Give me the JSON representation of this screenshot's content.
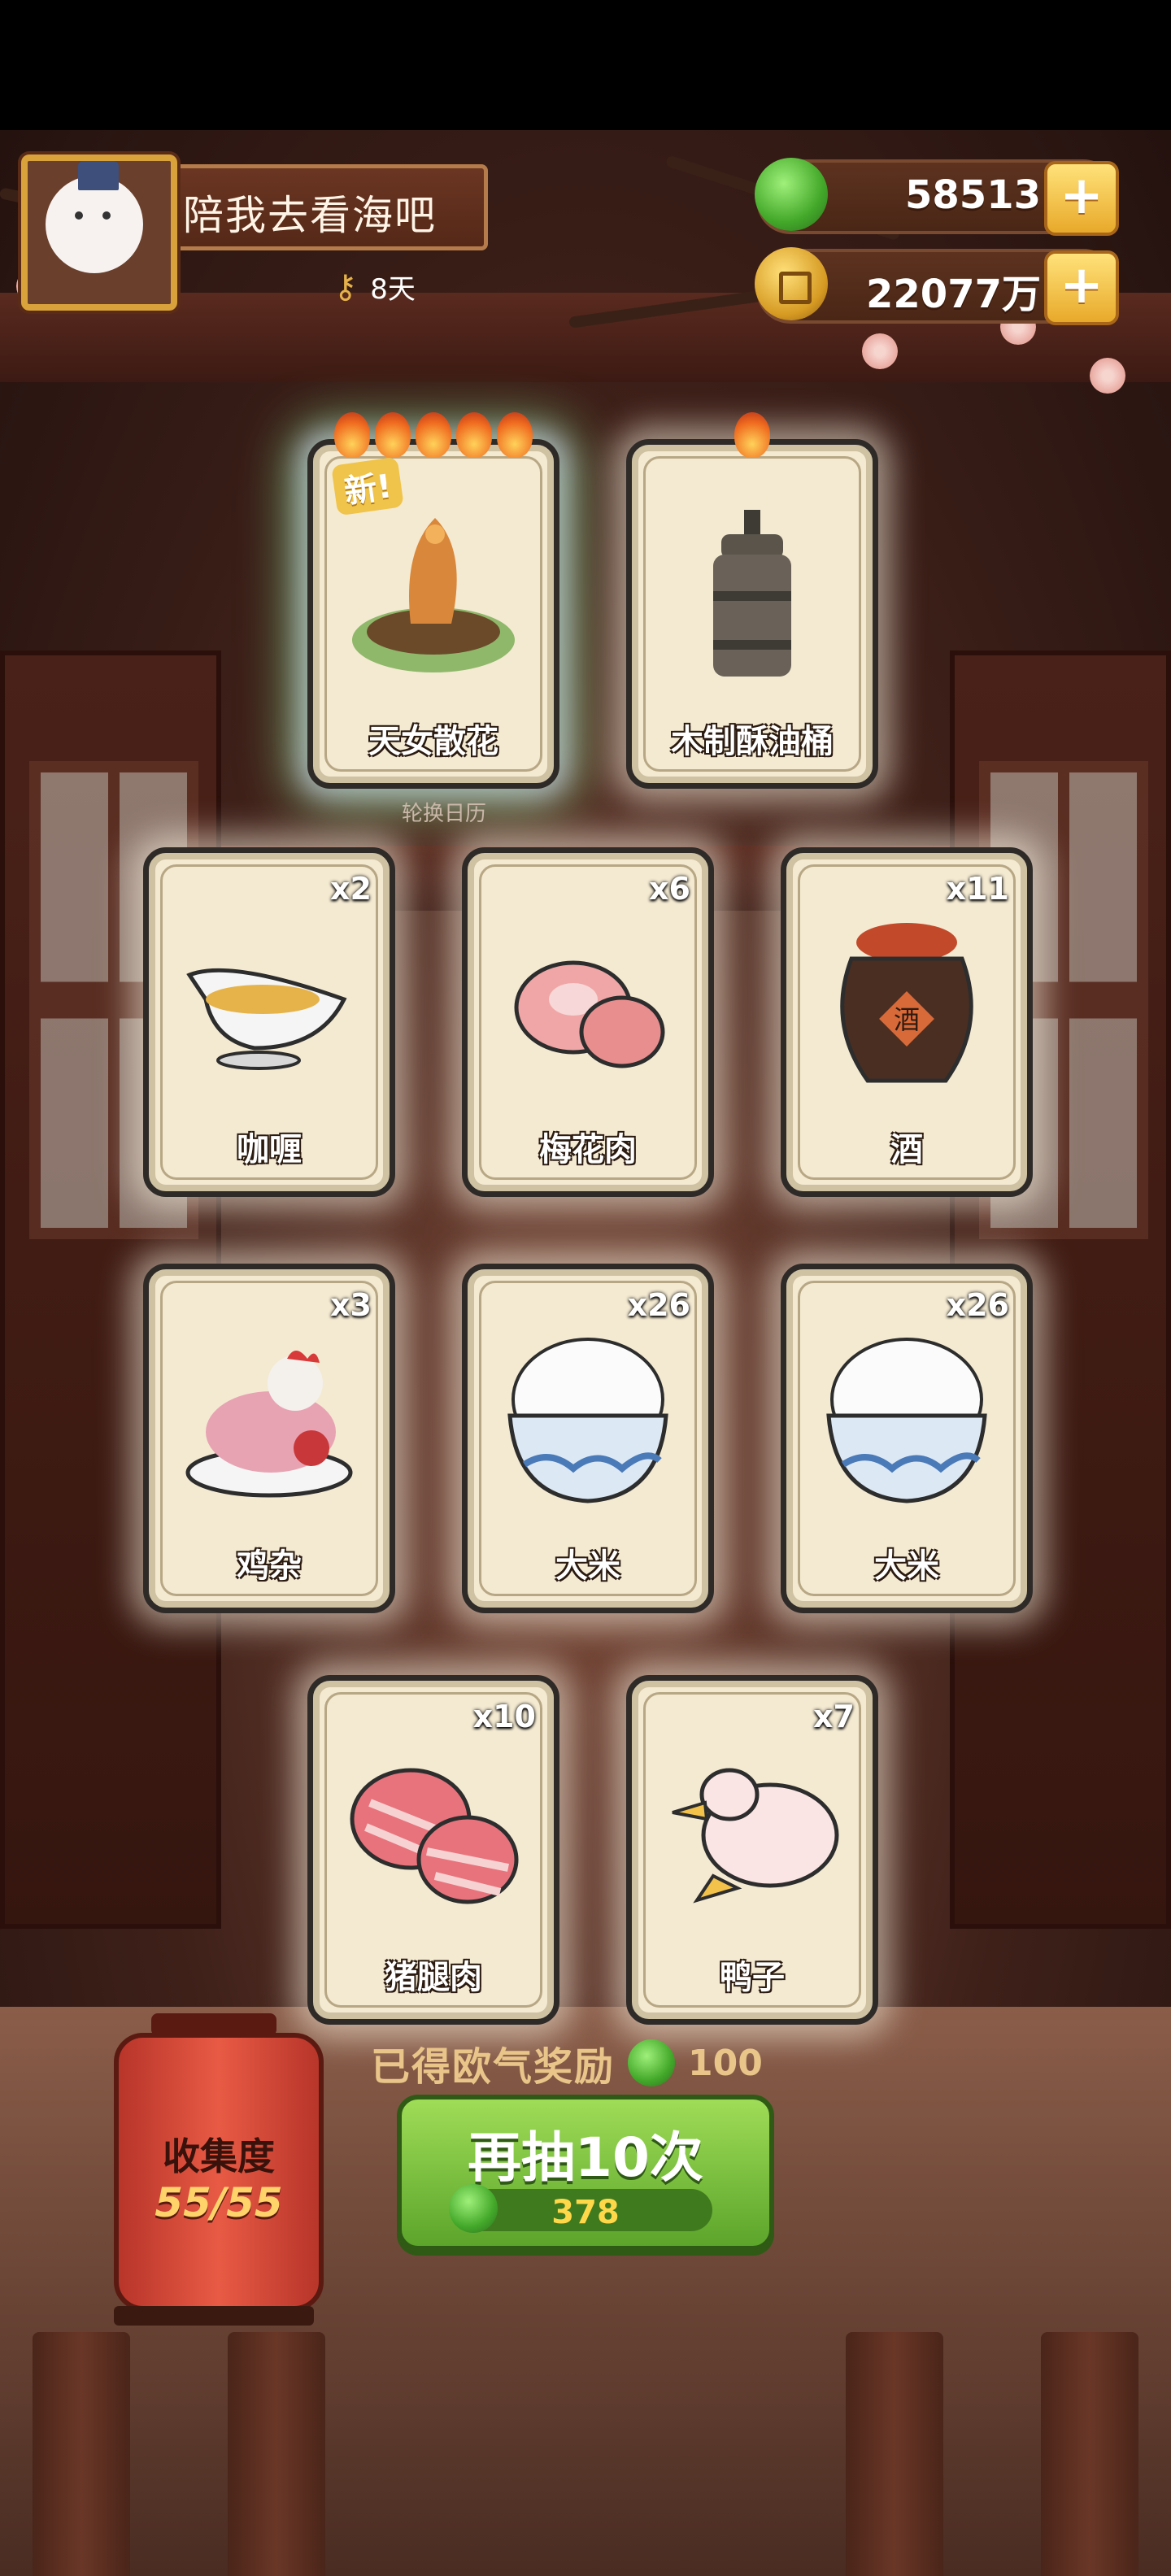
{
  "player": {
    "name": "陪我去看海吧",
    "days": "8天"
  },
  "resources": {
    "jade": "58513",
    "coins": "22077万"
  },
  "cards": [
    {
      "name": "天女散花",
      "qty": "",
      "new_label": "新!",
      "flames": 5,
      "art": "dish-icon"
    },
    {
      "name": "木制酥油桶",
      "qty": "",
      "new_label": "",
      "flames": 1,
      "art": "churn-icon"
    },
    {
      "name": "咖喱",
      "qty": "x2",
      "art": "gravy-boat-icon"
    },
    {
      "name": "梅花肉",
      "qty": "x6",
      "art": "meat-icon"
    },
    {
      "name": "酒",
      "qty": "x11",
      "art": "wine-jar-icon"
    },
    {
      "name": "鸡杂",
      "qty": "x3",
      "art": "chicken-icon"
    },
    {
      "name": "大米",
      "qty": "x26",
      "art": "rice-bowl-icon"
    },
    {
      "name": "大米",
      "qty": "x26",
      "art": "rice-bowl-icon"
    },
    {
      "name": "猪腿肉",
      "qty": "x10",
      "art": "pork-icon"
    },
    {
      "name": "鸭子",
      "qty": "x7",
      "art": "duck-icon"
    }
  ],
  "rotate_label": "轮换日历",
  "collection": {
    "title": "收集度",
    "value": "55/55"
  },
  "luck_reward": {
    "label": "已得欧气奖励",
    "value": "100"
  },
  "draw_button": {
    "label": "再抽10次",
    "cost": "378"
  },
  "colors": {
    "jade": "#43a82a",
    "coin": "#d69a22",
    "button": "#6fb535"
  }
}
